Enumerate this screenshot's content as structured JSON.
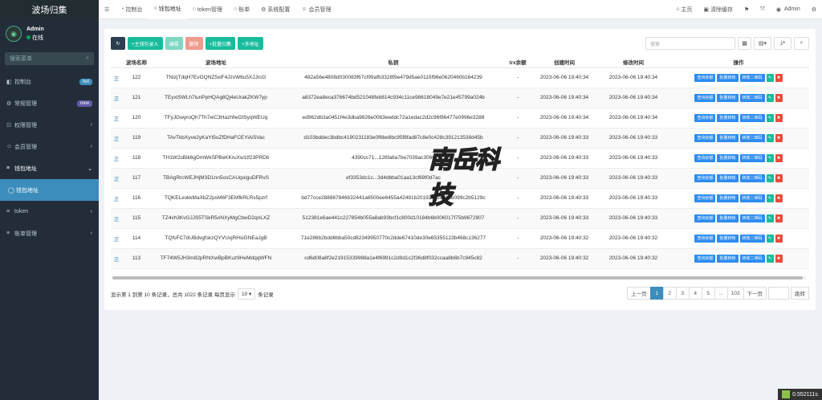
{
  "app": {
    "title": "波场归集"
  },
  "user": {
    "name": "Admin",
    "status": "在线"
  },
  "sidebar": {
    "search_placeholder": "搜索菜单",
    "items": [
      {
        "label": "控制台",
        "badge": "hot"
      },
      {
        "label": "常规管理",
        "badge": "new"
      },
      {
        "label": "权限管理"
      },
      {
        "label": "会员管理"
      },
      {
        "label": "钱包地址"
      },
      {
        "label": "钱包地址"
      },
      {
        "label": "token"
      },
      {
        "label": "账单管理"
      }
    ]
  },
  "topbar": {
    "tabs": [
      "控制台",
      "钱包地址",
      "token管理",
      "账单",
      "系统配置",
      "会员管理"
    ],
    "right": [
      "主页",
      "清除缓存",
      "Admin"
    ]
  },
  "toolbar": {
    "add_label": "+主钱包录入",
    "edit_label": "编辑",
    "delete_label": "删除",
    "batch_label": "+批量归集",
    "multi_label": "+多地址",
    "search_placeholder": "搜索"
  },
  "table": {
    "headers": [
      "",
      "波场名称",
      "波场地址",
      "私钥",
      "trx余额",
      "创建时间",
      "修改时间",
      "操作"
    ],
    "row_link": "正",
    "op_labels": [
      "查询余额",
      "批量转帐",
      "转账二维码"
    ],
    "rows": [
      {
        "id": "122",
        "addr": "TNizjTdqH7EvGQNZ5xiF4JzvW6u5XJJrcG",
        "key": "482a56e4808d030083f67cf99afb3328f9e479d5ae0115f96e0620460b164239",
        "trx": "-",
        "created": "2023-06-06 19:40:34",
        "modified": "2023-06-06 19:40:34"
      },
      {
        "id": "121",
        "addr": "TEyxiSWLh7iunPpHQAg8Qj4eUrakZKW7yp",
        "key": "a8372ea8eca376674bd521048feb814c934c11ce98618049e7e21e45799a024b",
        "trx": "-",
        "created": "2023-06-06 19:40:34",
        "modified": "2023-06-06 19:40:34"
      },
      {
        "id": "120",
        "addr": "TFyJGwyroQh7Th7eiC3HazhfwGtSyqWEUq",
        "key": "ed962db3a0451f4e3dba9826e0063eeddc72a1edac2d2c96f86477e0996e3288",
        "trx": "-",
        "created": "2023-06-06 19:40:34",
        "modified": "2023-06-06 19:40:34"
      },
      {
        "id": "119",
        "addr": "TAvTkbXyve2yKaYt5oZfDHaFCEYiAi5Vac",
        "key": "d103bddec3bdbc4190231183e0f6be8bc95f8fad87c8e0c428c391213538d45b",
        "trx": "-",
        "created": "2023-06-06 19:40:33",
        "modified": "2023-06-06 19:40:33"
      },
      {
        "id": "118",
        "addr": "TH1W2sBik6gDmWkSPBeKKruXw1tf23PRDb",
        "key": "4390cc71...126fa8a7be7039ac3060",
        "trx": "-",
        "created": "2023-06-06 19:40:33",
        "modified": "2023-06-06 19:40:33"
      },
      {
        "id": "117",
        "addr": "TBAgRrcWEJHjM3D1nn5osCAUqoiguDFRvS",
        "key": "ef3353dc1c...3d4dbba01aa13cf69f0d7ac",
        "trx": "-",
        "created": "2023-06-06 19:40:33",
        "modified": "2023-06-06 19:40:33"
      },
      {
        "id": "116",
        "addr": "TQKELxokkMaXbZ2psM6F3EMfkRLRs5pzrf",
        "key": "bd77cce288867846b32441a6500ee6455a42491b201926c2c913b099c2b5129c",
        "trx": "-",
        "created": "2023-06-06 19:40:33",
        "modified": "2023-06-06 19:40:33"
      },
      {
        "id": "115",
        "addr": "TZ4vh3KvGJJS5TSkR5oNXyMgCbwD2qnLXZ",
        "key": "512381e6ae441c227854b055a8ab93bcf1c800d10184b6b006017f75b9672807",
        "trx": "-",
        "created": "2023-06-06 19:40:33",
        "modified": "2023-06-06 19:40:33"
      },
      {
        "id": "114",
        "addr": "TQfsFC7dUBdvgfskzQYVUxjRHsiGNEaJgB",
        "key": "71e286b2bdd6bba50cd82349950770c2dde67410de30e65355123b468c136277",
        "trx": "-",
        "created": "2023-06-06 19:40:32",
        "modified": "2023-06-06 19:40:32"
      },
      {
        "id": "113",
        "addr": "TF74W5JH3m82pRhtXwBpBKuz9HeMdqqWFN",
        "key": "cd6d08a8f2e21915339988a1e4f6991c2d9d1c2f36d8f032ccaa8b6b7c945c82",
        "trx": "-",
        "created": "2023-06-06 19:40:32",
        "modified": "2023-06-06 19:40:32"
      }
    ]
  },
  "pagination": {
    "info_prefix": "显示第 1 到第 10 条记录，总共 1022 条记录 每页显示",
    "page_size": "10",
    "info_suffix": "条记录",
    "prev": "上一页",
    "pages": [
      "1",
      "2",
      "3",
      "4",
      "5",
      "...",
      "103"
    ],
    "next": "下一页",
    "jump": "跳转"
  },
  "watermark": {
    "text": "南岳科技"
  },
  "timer": {
    "value": "0.552111s"
  }
}
